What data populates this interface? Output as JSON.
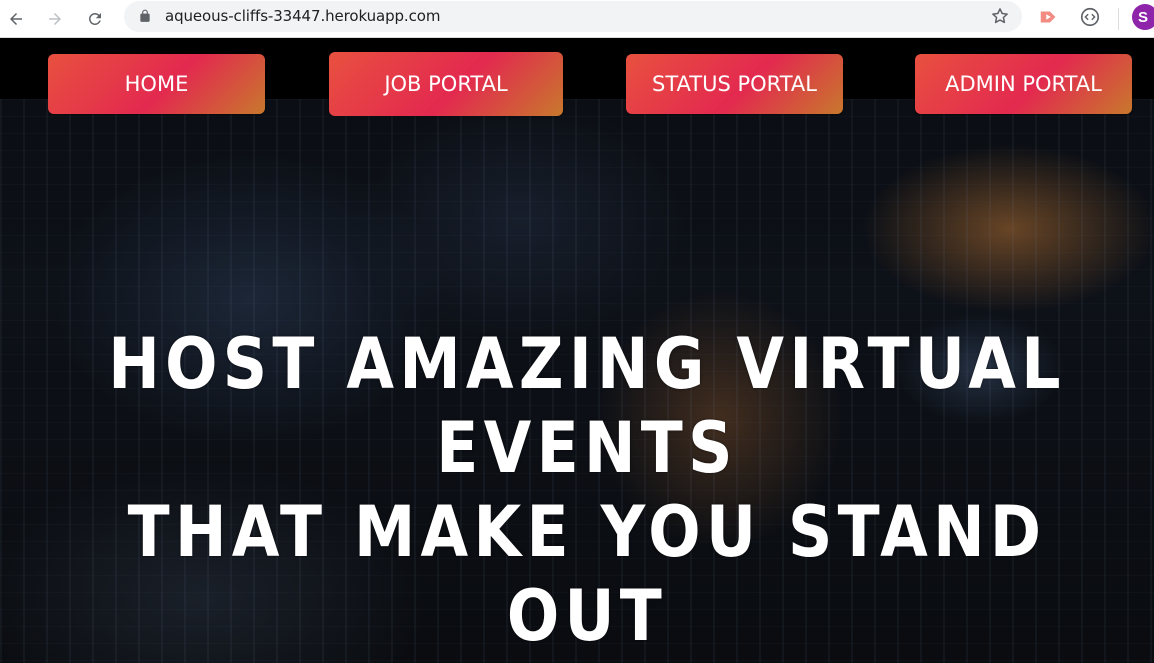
{
  "browser": {
    "url": "aqueous-cliffs-33447.herokuapp.com",
    "avatar_letter": "S",
    "icons": [
      "back-arrow-icon",
      "forward-arrow-icon",
      "reload-icon",
      "lock-icon",
      "star-icon",
      "extension-play-icon",
      "extension-code-icon"
    ]
  },
  "nav": {
    "home": "HOME",
    "job_portal": "JOB PORTAL",
    "status_portal": "STATUS PORTAL",
    "admin_portal": "ADMIN PORTAL"
  },
  "hero": {
    "line1": "HOST AMAZING VIRTUAL",
    "line2": "EVENTS",
    "line3": "THAT MAKE YOU STAND",
    "line4": "OUT"
  },
  "colors": {
    "button_gradient_start": "#e8513f",
    "button_gradient_mid": "#e3294f",
    "button_gradient_end": "#c8782d",
    "avatar": "#8e24aa"
  }
}
